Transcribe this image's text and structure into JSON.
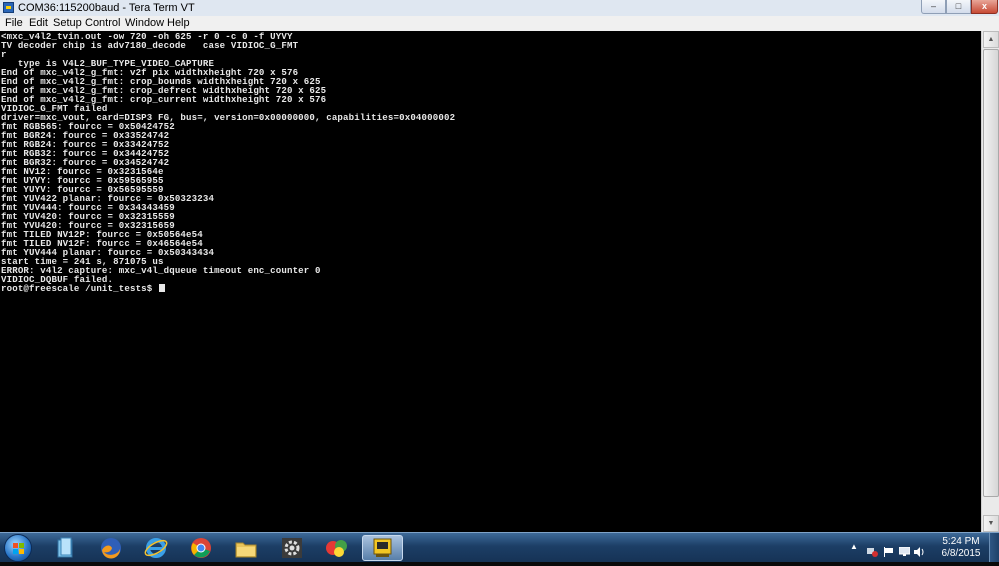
{
  "window": {
    "title": "COM36:115200baud - Tera Term VT",
    "icon": "tera-term-icon",
    "controls": {
      "minimize": "–",
      "maximize": "□",
      "close": "x"
    }
  },
  "menu": [
    "File",
    "Edit",
    "Setup",
    "Control",
    "Window",
    "Help"
  ],
  "terminal": {
    "lines": [
      "<mxc_v4l2_tvin.out -ow 720 -oh 625 -r 0 -c 0 -f UYVY",
      "TV decoder chip is adv7180_decode   case VIDIOC_G_FMT",
      "r",
      "   type is V4L2_BUF_TYPE_VIDEO_CAPTURE",
      "End of mxc_v4l2_g_fmt: v2f pix widthxheight 720 x 576",
      "End of mxc_v4l2_g_fmt: crop_bounds widthxheight 720 x 625",
      "End of mxc_v4l2_g_fmt: crop_defrect widthxheight 720 x 625",
      "End of mxc_v4l2_g_fmt: crop_current widthxheight 720 x 576",
      "VIDIOC_G_FMT failed",
      "driver=mxc_vout, card=DISP3 FG, bus=, version=0x00000000, capabilities=0x04000002",
      "fmt RGB565: fourcc = 0x50424752",
      "fmt BGR24: fourcc = 0x33524742",
      "fmt RGB24: fourcc = 0x33424752",
      "fmt RGB32: fourcc = 0x34424752",
      "fmt BGR32: fourcc = 0x34524742",
      "fmt NV12: fourcc = 0x3231564e",
      "fmt UYVY: fourcc = 0x59565955",
      "fmt YUYV: fourcc = 0x56595559",
      "fmt YUV422 planar: fourcc = 0x50323234",
      "fmt YUV444: fourcc = 0x34343459",
      "fmt YUV420: fourcc = 0x32315559",
      "fmt YVU420: fourcc = 0x32315659",
      "fmt TILED NV12P: fourcc = 0x50564e54",
      "fmt TILED NV12F: fourcc = 0x46564e54",
      "fmt YUV444 planar: fourcc = 0x50343434",
      "start time = 241 s, 871075 us",
      "ERROR: v4l2 capture: mxc_v4l_dqueue timeout enc_counter 0",
      "VIDIOC_DQBUF failed.",
      "root@freescale /unit_tests$ "
    ]
  },
  "taskbar": {
    "start": "windows-start-orb",
    "pinned": [
      {
        "name": "windows-explorer-icon"
      },
      {
        "name": "firefox-icon"
      },
      {
        "name": "internet-explorer-icon"
      },
      {
        "name": "chrome-icon"
      },
      {
        "name": "file-folder-icon"
      },
      {
        "name": "settings-gear-icon"
      },
      {
        "name": "colorful-app-icon"
      },
      {
        "name": "tera-term-taskbar-icon"
      }
    ],
    "clock": {
      "time": "5:24 PM",
      "date": "6/8/2015"
    },
    "tray": {
      "chevron": "▲",
      "icons": [
        "network-error-icon",
        "flag-icon",
        "monitor-icon",
        "volume-icon"
      ]
    }
  },
  "colors": {
    "terminal_bg": "#000000",
    "terminal_fg": "#e8e8e8",
    "taskbar": "#1c3e66",
    "titlebar": "#dfe7f1"
  }
}
